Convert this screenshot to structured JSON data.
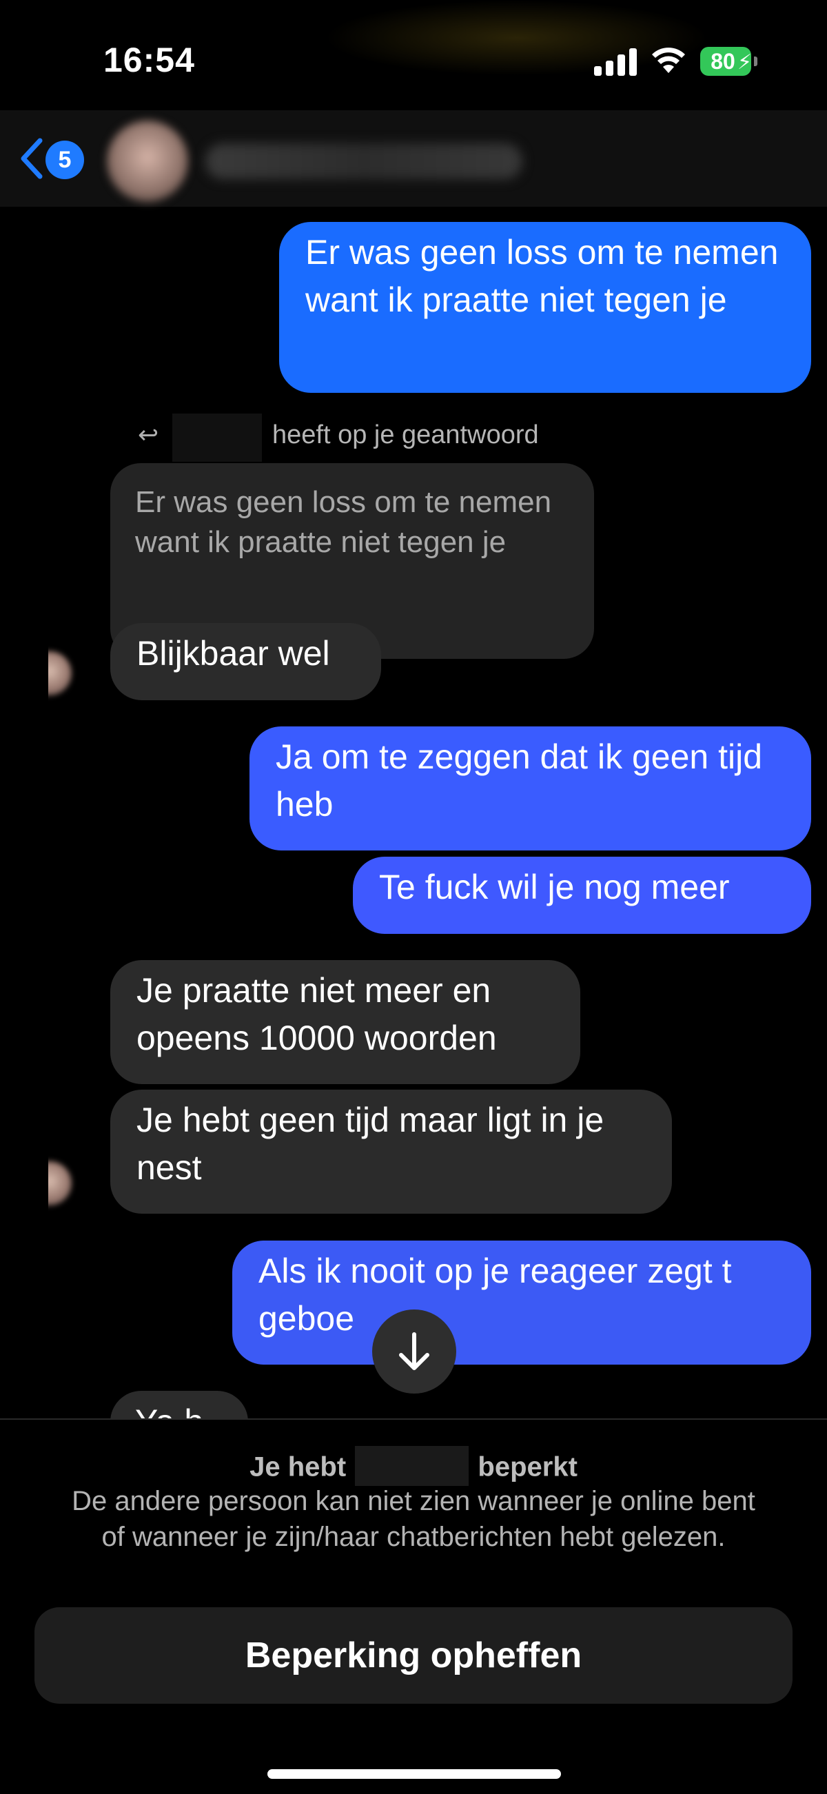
{
  "status_bar": {
    "time": "16:54",
    "battery": "80",
    "battery_color": "#33c759"
  },
  "header": {
    "unread_count": "5",
    "accent": "#1f7bff",
    "back_icon": "chevron-left-icon",
    "avatar": "blurred",
    "name": "blurred"
  },
  "messages": [
    {
      "side": "sent",
      "text": "Er was geen loss om te nemen want ik praatte niet tegen je",
      "color": "#1a6cff"
    },
    {
      "side": "received",
      "reply_label": "heeft op je geantwoord",
      "quoted_text": "Er was geen loss om te nemen want ik praatte niet tegen je"
    },
    {
      "side": "received",
      "text": "Blijkbaar wel"
    },
    {
      "side": "sent",
      "text": "Ja om te zeggen dat ik geen tijd heb",
      "color": "#3a5cff"
    },
    {
      "side": "sent",
      "text": "Te fuck wil je nog meer",
      "color": "#3f59ff"
    },
    {
      "side": "received",
      "text": "Je praatte niet meer en opeens 10000 woorden"
    },
    {
      "side": "received",
      "text": "Je hebt geen tijd maar ligt in je nest"
    },
    {
      "side": "sent",
      "text": "Als ik nooit op je reageer zegt t geboe",
      "color": "#3c5af5"
    },
    {
      "side": "received",
      "text": "Ya h",
      "partial": true
    }
  ],
  "scroll_button": {
    "icon": "arrow-down-icon"
  },
  "footer": {
    "restrict_title_prefix": "Je hebt",
    "restrict_title_suffix": "beperkt",
    "restrict_description": "De andere persoon kan niet zien wanneer je online bent of wanneer je zijn/haar chatberichten hebt gelezen.",
    "unrestrict_button": "Beperking opheffen"
  }
}
